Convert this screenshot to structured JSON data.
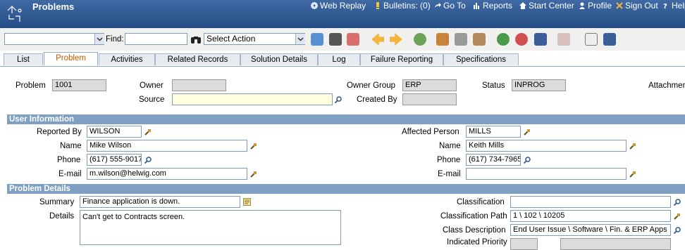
{
  "header": {
    "title": "Problems",
    "links": [
      {
        "label": "Web Replay",
        "icon": "play-icon"
      },
      {
        "label": "Bulletins: (0)",
        "icon": "bulletin-icon"
      },
      {
        "label": "Go To",
        "icon": "goto-arrow-icon"
      },
      {
        "label": "Reports",
        "icon": "reports-chart-icon"
      },
      {
        "label": "Start Center",
        "icon": "home-icon"
      },
      {
        "label": "Profile",
        "icon": "person-icon"
      },
      {
        "label": "Sign Out",
        "icon": "x-icon"
      },
      {
        "label": "Help",
        "icon": "help-question-icon"
      }
    ]
  },
  "toolbar": {
    "find_label": "Find:",
    "find_value": "",
    "action_select": "Select Action"
  },
  "tabs": [
    "List",
    "Problem",
    "Activities",
    "Related Records",
    "Solution Details",
    "Log",
    "Failure Reporting",
    "Specifications"
  ],
  "active_tab": "Problem",
  "top": {
    "problem_label": "Problem",
    "problem_value": "1001",
    "owner_label": "Owner",
    "owner_value": "",
    "owner_group_label": "Owner Group",
    "owner_group_value": "ERP",
    "status_label": "Status",
    "status_value": "INPROG",
    "attachments_label": "Attachmen",
    "source_label": "Source",
    "source_value": "",
    "created_by_label": "Created By",
    "created_by_value": ""
  },
  "user_info": {
    "section_title": "User Information",
    "reported_by_label": "Reported By",
    "reported_by_value": "WILSON",
    "name_label": "Name",
    "name_value": "Mike Wilson",
    "phone_label": "Phone",
    "phone_value": "(617) 555-9017",
    "email_label": "E-mail",
    "email_value": "m.wilson@helwig.com",
    "affected_person_label": "Affected Person",
    "affected_person_value": "MILLS",
    "aff_name_label": "Name",
    "aff_name_value": "Keith Mills",
    "aff_phone_label": "Phone",
    "aff_phone_value": "(617) 734-7965",
    "aff_email_label": "E-mail",
    "aff_email_value": ""
  },
  "problem_details": {
    "section_title": "Problem Details",
    "summary_label": "Summary",
    "summary_value": "Finance application is down.",
    "details_label": "Details",
    "details_value": "Can't get to Contracts screen.",
    "classification_label": "Classification",
    "classification_value": "",
    "class_path_label": "Classification Path",
    "class_path_value": "1 \\ 102 \\ 10205",
    "class_desc_label": "Class Description",
    "class_desc_value": "End User Issue \\ Software \\ Fin. & ERP Apps",
    "cut_label": "Indicated Priority"
  }
}
